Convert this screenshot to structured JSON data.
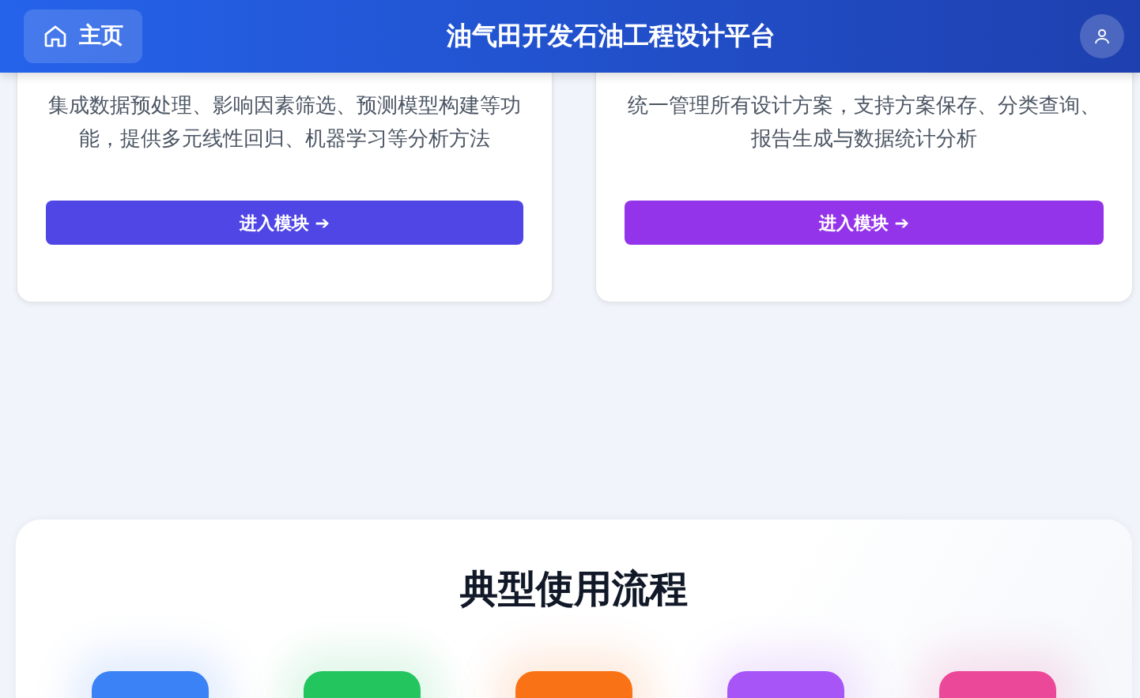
{
  "header": {
    "home": "主页",
    "title": "油气田开发石油工程设计平台"
  },
  "modules": [
    {
      "description": "集成数据预处理、影响因素筛选、预测模型构建等功能，提供多元线性回归、机器学习等分析方法",
      "button": "进入模块 ➔",
      "color": "#4f46e5"
    },
    {
      "description": "统一管理所有设计方案，支持方案保存、分类查询、报告生成与数据统计分析",
      "button": "进入模块 ➔",
      "color": "#9333ea"
    }
  ],
  "workflow": {
    "title": "典型使用流程",
    "steps": [
      {
        "color": "#3b82f6"
      },
      {
        "color": "#22c55e"
      },
      {
        "color": "#f97316"
      },
      {
        "color": "#a855f7"
      },
      {
        "color": "#ec4899"
      }
    ]
  }
}
